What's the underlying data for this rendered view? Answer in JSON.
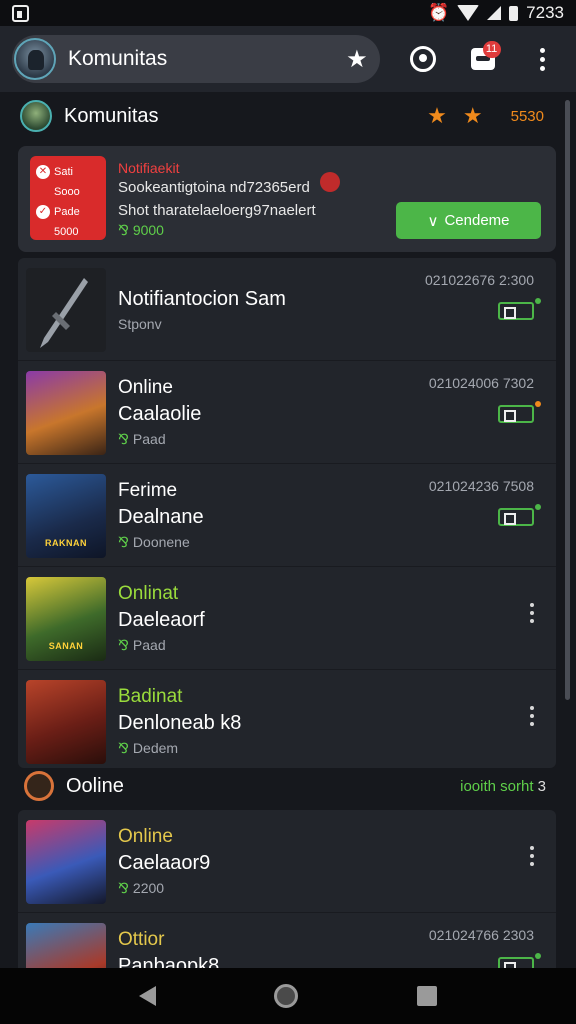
{
  "status_bar": {
    "time": "7233"
  },
  "app_bar": {
    "title": "Komunitas",
    "notification_badge": "11",
    "icons": [
      "app-avatar",
      "star-icon",
      "ghost-icon",
      "inbox-icon",
      "more-vert-icon"
    ]
  },
  "section1": {
    "title": "Komunitas",
    "value": "5530"
  },
  "notification": {
    "title": "Notifiaekit",
    "line1": "Sookeantigtoina nd72365erd",
    "line2": "Shot tharatelaeloerg97naelert",
    "stat": "9000",
    "confirm_label": "Cendeme",
    "thumb_rows": [
      "Sati",
      "Sooo",
      "Pade",
      "5000"
    ]
  },
  "rows": [
    {
      "status": "",
      "name": "Notifiantocion Sam",
      "sub": "Stponv",
      "time": "021022676 2:300",
      "action": "tag"
    },
    {
      "status": "Online",
      "name": "Caalaolie",
      "sub": "Paad",
      "time": "021024006 7302",
      "action": "tag-orange"
    },
    {
      "status": "Ferime",
      "name": "Dealnane",
      "sub": "Doonene",
      "time": "021024236 7508",
      "action": "tag",
      "thumb_text": "RAKNAN"
    },
    {
      "status": "Onlinat",
      "name": "Daeleaorf",
      "sub": "Paad",
      "time": "",
      "action": "more",
      "thumb_text": "SANAN"
    },
    {
      "status": "Badinat",
      "name": "Denloneab k8",
      "sub": "Dedem",
      "time": "",
      "action": "more"
    }
  ],
  "section2": {
    "title": "Ooline",
    "link": "iooith sorht",
    "count": "3"
  },
  "rows2": [
    {
      "status": "Online",
      "name": "Caelaaor9",
      "sub": "2200",
      "time": "",
      "action": "more"
    },
    {
      "status": "Ottior",
      "name": "Panbaopk8",
      "sub": "",
      "time": "021024766 2303",
      "action": "tag"
    }
  ],
  "colors": {
    "accent_green": "#4cb648",
    "accent_orange": "#f08a1c",
    "alert_red": "#d92b2b"
  }
}
